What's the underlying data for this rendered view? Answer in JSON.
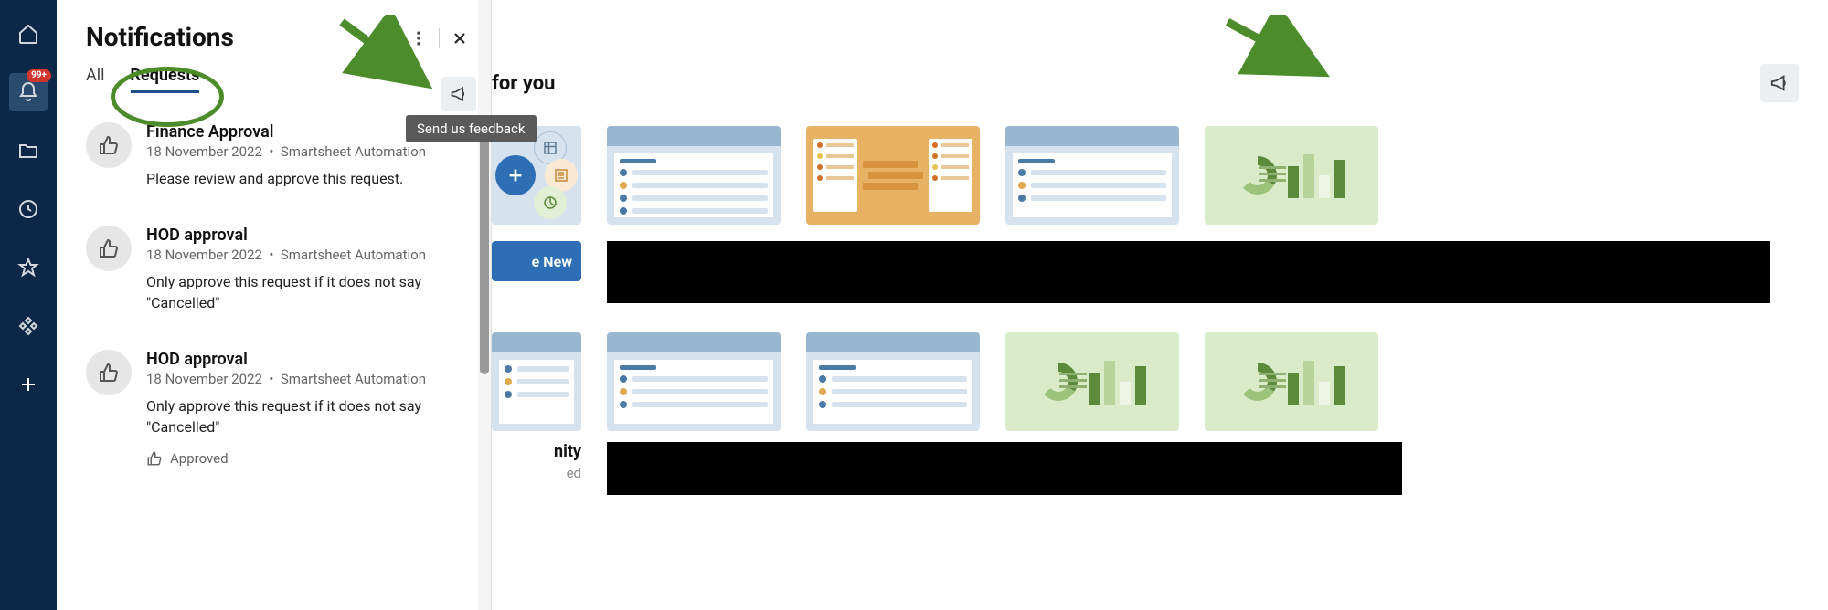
{
  "sidebar": {
    "notifications_badge": "99+"
  },
  "panel": {
    "title": "Notifications",
    "tabs": {
      "all": "All",
      "requests": "Requests"
    },
    "feedback_tooltip": "Send us feedback",
    "items": [
      {
        "title": "Finance Approval",
        "date": "18 November 2022",
        "source": "Smartsheet Automation",
        "text": "Please review and approve this request."
      },
      {
        "title": "HOD approval",
        "date": "18 November 2022",
        "source": "Smartsheet Automation",
        "text": "Only approve this request if it does not say \"Cancelled\""
      },
      {
        "title": "HOD approval",
        "date": "18 November 2022",
        "source": "Smartsheet Automation",
        "text": "Only approve this request if it does not say \"Cancelled\"",
        "status": "Approved"
      }
    ]
  },
  "main": {
    "title_fragment": "for you",
    "create_label": "e New",
    "community_fragment": "nity",
    "trunc": "ed"
  }
}
